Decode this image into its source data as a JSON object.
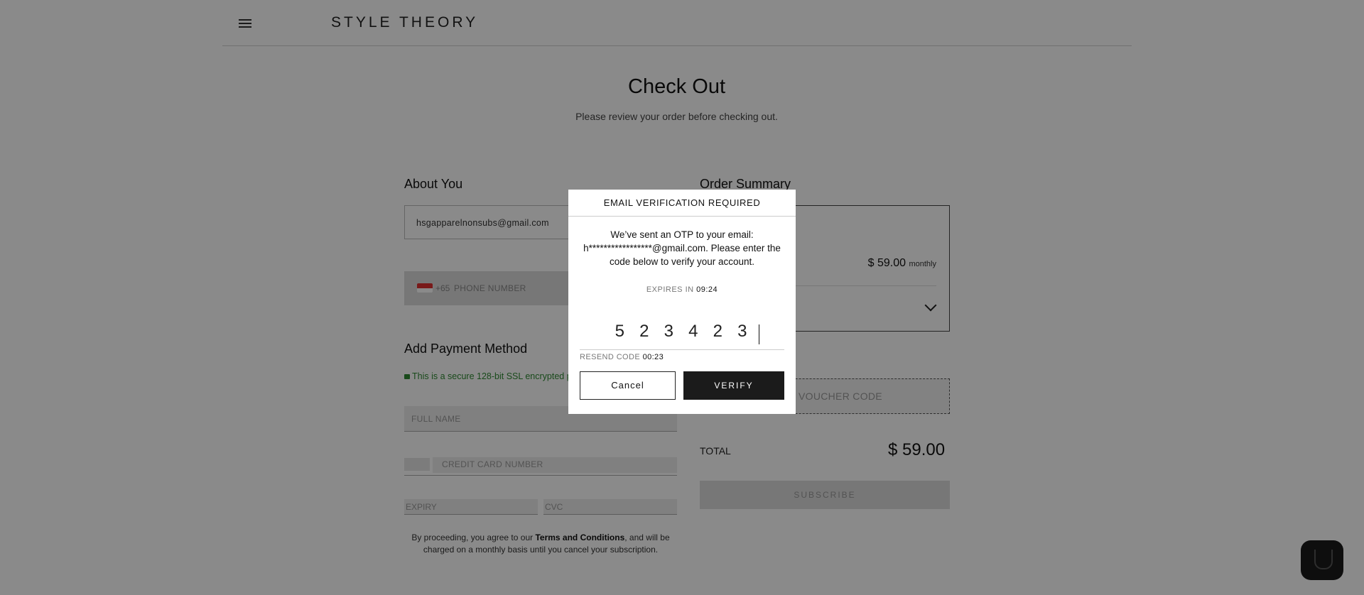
{
  "header": {
    "logo": "STYLE THEORY",
    "menu_icon": "hamburger-icon"
  },
  "page": {
    "title": "Check Out",
    "subtitle": "Please review your order before checking out."
  },
  "about": {
    "title": "About You",
    "email_value": "hsgapparelnonsubs@gmail.com",
    "phone_code": "+65",
    "phone_placeholder": "PHONE NUMBER",
    "flag_icon": "singapore-flag-icon"
  },
  "payment": {
    "title": "Add Payment Method",
    "secure_text": "This is a secure 128-bit SSL encrypted p",
    "fullname_placeholder": "FULL NAME",
    "card_placeholder": "CREDIT CARD NUMBER",
    "expiry_placeholder": "EXPIRY",
    "cvc_placeholder": "CVC",
    "terms_prefix": "By proceeding, you agree to our ",
    "terms_link": "Terms and Conditions",
    "terms_suffix": ", and will be charged on a monthly basis until you cancel your subscription."
  },
  "summary": {
    "title": "Order Summary",
    "price": "$ 59.00",
    "price_period": "monthly",
    "voucher_placeholder": "VOUCHER CODE",
    "total_label": "TOTAL",
    "total_value": "$ 59.00",
    "subscribe_label": "SUBSCRIBE"
  },
  "modal": {
    "title": "EMAIL VERIFICATION REQUIRED",
    "message": "We’ve sent an OTP to your email: h*****************@gmail.com. Please enter the code below to verify your account.",
    "expires_label": "EXPIRES IN",
    "expires_value": "09:24",
    "otp_digits": [
      "5",
      "2",
      "3",
      "4",
      "2",
      "3"
    ],
    "resend_label": "RESEND CODE",
    "resend_value": "00:23",
    "cancel_label": "Cancel",
    "verify_label": "VERIFY"
  },
  "colors": {
    "overlay": "#000000",
    "secure_green": "#2f8a33",
    "primary_dark": "#1b1b1b"
  }
}
